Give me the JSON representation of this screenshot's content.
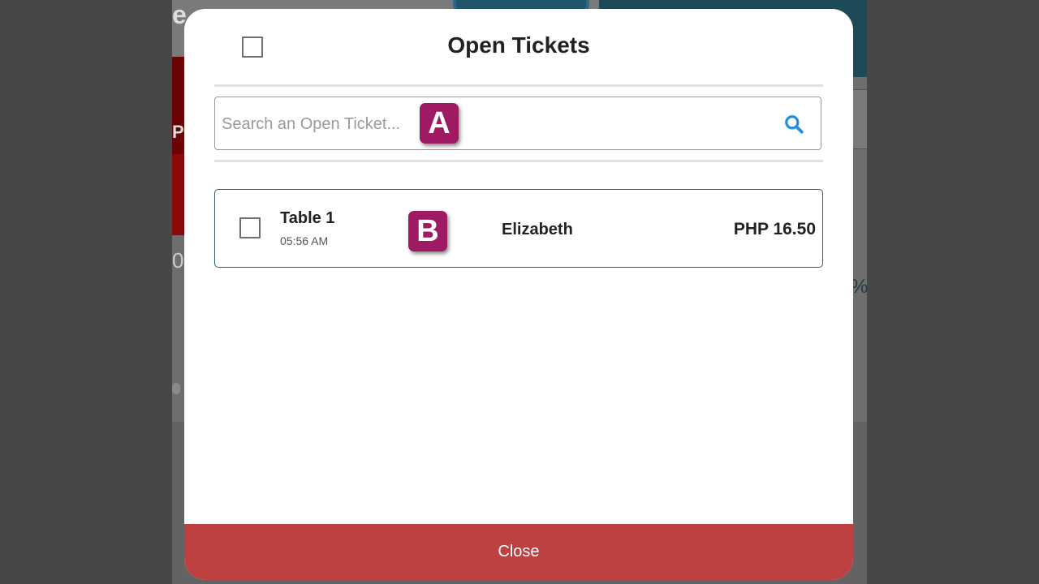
{
  "background": {
    "brand_fragment": "e.",
    "red_fragment": "P",
    "red_number_fragment": "0.",
    "percent_fragment": "%"
  },
  "modal": {
    "title": "Open Tickets",
    "search": {
      "placeholder": "Search an Open Ticket...",
      "value": "",
      "icon": "search-icon"
    },
    "tickets": [
      {
        "table": "Table 1",
        "time": "05:56 AM",
        "user": "Elizabeth",
        "amount": "PHP 16.50"
      }
    ],
    "close_label": "Close"
  },
  "annotations": {
    "a": "A",
    "b": "B"
  },
  "colors": {
    "close_button": "#bd4141",
    "badge": "#9e1a62",
    "search_icon": "#1f8fe0",
    "row_border": "#2f5f66",
    "overlay": "#474747"
  }
}
